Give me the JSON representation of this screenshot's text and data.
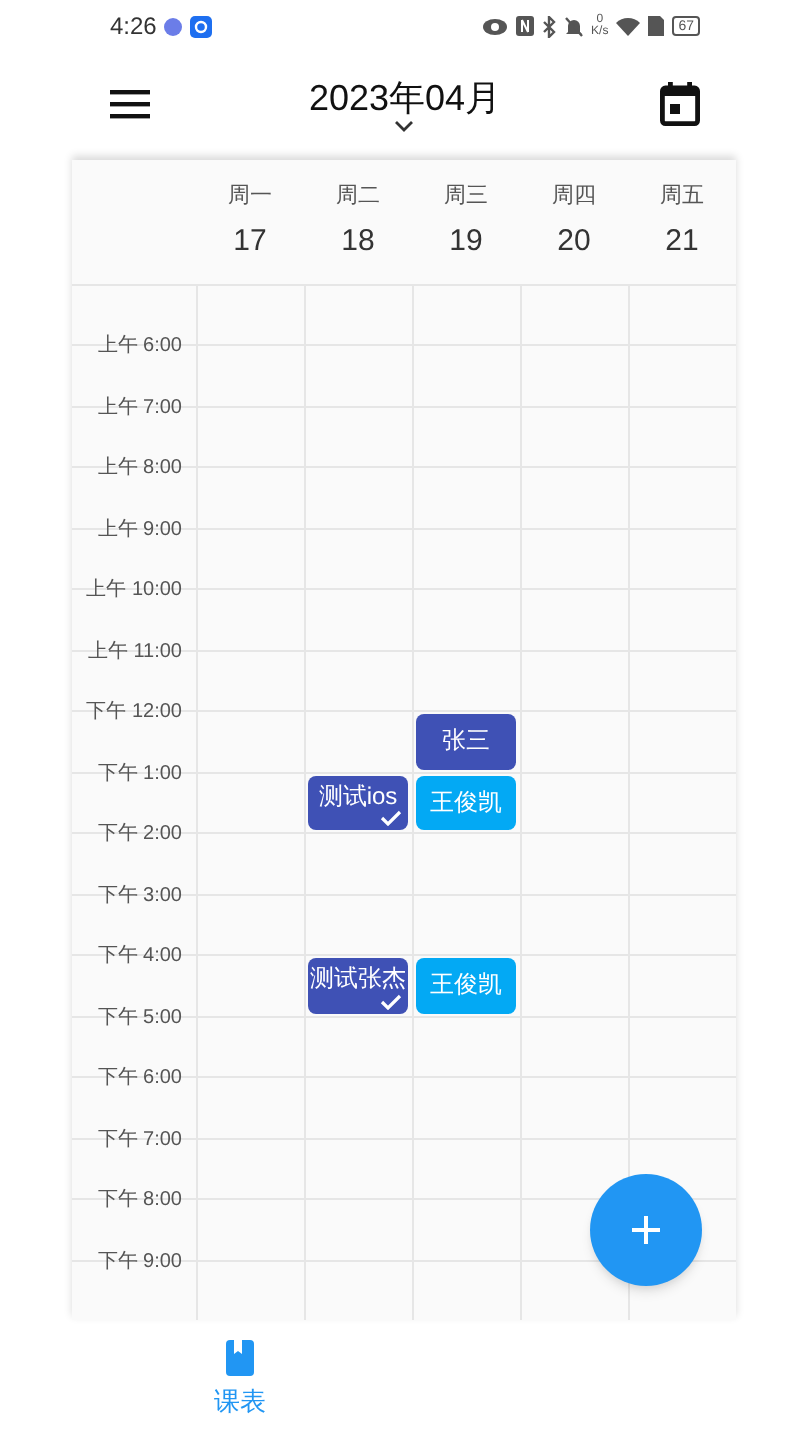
{
  "status_bar": {
    "time": "4:26",
    "network_speed_value": "0",
    "network_speed_unit": "K/s",
    "battery": "67"
  },
  "toolbar": {
    "title": "2023年04月"
  },
  "days": [
    {
      "weekday": "周一",
      "date": "17"
    },
    {
      "weekday": "周二",
      "date": "18"
    },
    {
      "weekday": "周三",
      "date": "19"
    },
    {
      "weekday": "周四",
      "date": "20"
    },
    {
      "weekday": "周五",
      "date": "21"
    }
  ],
  "rows": [
    {
      "time": "上午 6:00",
      "slots": [
        {
          "kind": "empty"
        },
        {
          "kind": "empty"
        },
        {
          "kind": "empty"
        },
        {
          "kind": "empty"
        },
        {
          "kind": "empty"
        }
      ]
    },
    {
      "time": "上午 7:00",
      "slots": [
        {
          "kind": "empty"
        },
        {
          "kind": "empty"
        },
        {
          "kind": "empty"
        },
        {
          "kind": "empty"
        },
        {
          "kind": "empty"
        }
      ]
    },
    {
      "time": "上午 8:00",
      "slots": [
        {
          "kind": "empty"
        },
        {
          "kind": "empty"
        },
        {
          "kind": "empty"
        },
        {
          "kind": "empty"
        },
        {
          "kind": "empty"
        }
      ]
    },
    {
      "time": "上午 9:00",
      "slots": [
        {
          "kind": "empty"
        },
        {
          "kind": "empty"
        },
        {
          "kind": "empty"
        },
        {
          "kind": "empty"
        },
        {
          "kind": "empty"
        }
      ]
    },
    {
      "time": "上午 10:00",
      "slots": [
        {
          "kind": "empty"
        },
        {
          "kind": "empty"
        },
        {
          "kind": "empty"
        },
        {
          "kind": "empty"
        },
        {
          "kind": "empty"
        }
      ]
    },
    {
      "time": "上午 11:00",
      "slots": [
        {
          "kind": "empty"
        },
        {
          "kind": "empty"
        },
        {
          "kind": "empty"
        },
        {
          "kind": "empty"
        },
        {
          "kind": "empty"
        }
      ]
    },
    {
      "time": "下午 12:00",
      "slots": [
        {
          "kind": "empty"
        },
        {
          "kind": "empty"
        },
        {
          "kind": "course",
          "title": "张三",
          "color": "#3f51b5",
          "completed": false
        },
        {
          "kind": "empty"
        },
        {
          "kind": "empty"
        }
      ]
    },
    {
      "time": "下午 1:00",
      "slots": [
        {
          "kind": "empty"
        },
        {
          "kind": "course",
          "title": "测试ios",
          "color": "#3f51b5",
          "completed": true
        },
        {
          "kind": "course",
          "title": "王俊凯",
          "color": "#03a9f4",
          "completed": false
        },
        {
          "kind": "empty"
        },
        {
          "kind": "empty"
        }
      ]
    },
    {
      "time": "下午 2:00",
      "slots": [
        {
          "kind": "empty"
        },
        {
          "kind": "empty"
        },
        {
          "kind": "empty"
        },
        {
          "kind": "empty"
        },
        {
          "kind": "empty"
        }
      ]
    },
    {
      "time": "下午 3:00",
      "slots": [
        {
          "kind": "empty"
        },
        {
          "kind": "empty"
        },
        {
          "kind": "empty"
        },
        {
          "kind": "empty"
        },
        {
          "kind": "empty"
        }
      ]
    },
    {
      "time": "下午 4:00",
      "slots": [
        {
          "kind": "empty"
        },
        {
          "kind": "course",
          "title": "测试张杰",
          "color": "#3f51b5",
          "completed": true
        },
        {
          "kind": "course",
          "title": "王俊凯",
          "color": "#03a9f4",
          "completed": false
        },
        {
          "kind": "empty"
        },
        {
          "kind": "empty"
        }
      ]
    },
    {
      "time": "下午 5:00",
      "slots": [
        {
          "kind": "empty"
        },
        {
          "kind": "empty"
        },
        {
          "kind": "empty"
        },
        {
          "kind": "empty"
        },
        {
          "kind": "empty"
        }
      ]
    },
    {
      "time": "下午 6:00",
      "slots": [
        {
          "kind": "empty"
        },
        {
          "kind": "empty"
        },
        {
          "kind": "empty"
        },
        {
          "kind": "empty"
        },
        {
          "kind": "empty"
        }
      ]
    },
    {
      "time": "下午 7:00",
      "slots": [
        {
          "kind": "empty"
        },
        {
          "kind": "empty"
        },
        {
          "kind": "empty"
        },
        {
          "kind": "empty"
        },
        {
          "kind": "empty"
        }
      ]
    },
    {
      "time": "下午 8:00",
      "slots": [
        {
          "kind": "empty"
        },
        {
          "kind": "empty"
        },
        {
          "kind": "empty"
        },
        {
          "kind": "empty"
        },
        {
          "kind": "empty"
        }
      ]
    },
    {
      "time": "下午 9:00",
      "slots": [
        {
          "kind": "empty"
        },
        {
          "kind": "empty"
        },
        {
          "kind": "empty"
        },
        {
          "kind": "empty"
        },
        {
          "kind": "empty"
        }
      ]
    }
  ],
  "bottom_nav": [
    {
      "label": "课表",
      "selected": true
    }
  ]
}
